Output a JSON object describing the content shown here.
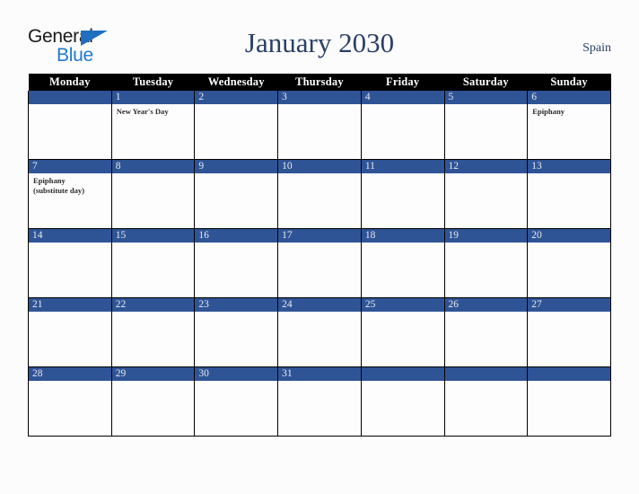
{
  "brand": {
    "name_part1": "General",
    "name_part2": "Blue",
    "accent_color": "#1f7ad0"
  },
  "header": {
    "title": "January 2030",
    "country": "Spain",
    "title_color": "#2b4066"
  },
  "calendar": {
    "month": "January",
    "year": "2030",
    "weekday_headers": [
      "Monday",
      "Tuesday",
      "Wednesday",
      "Thursday",
      "Friday",
      "Saturday",
      "Sunday"
    ],
    "header_bg": "#000000",
    "daynum_bg": "#2f5496",
    "weeks": [
      [
        {
          "day": "",
          "event": ""
        },
        {
          "day": "1",
          "event": "New Year's Day"
        },
        {
          "day": "2",
          "event": ""
        },
        {
          "day": "3",
          "event": ""
        },
        {
          "day": "4",
          "event": ""
        },
        {
          "day": "5",
          "event": ""
        },
        {
          "day": "6",
          "event": "Epiphany"
        }
      ],
      [
        {
          "day": "7",
          "event": "Epiphany\n(substitute day)"
        },
        {
          "day": "8",
          "event": ""
        },
        {
          "day": "9",
          "event": ""
        },
        {
          "day": "10",
          "event": ""
        },
        {
          "day": "11",
          "event": ""
        },
        {
          "day": "12",
          "event": ""
        },
        {
          "day": "13",
          "event": ""
        }
      ],
      [
        {
          "day": "14",
          "event": ""
        },
        {
          "day": "15",
          "event": ""
        },
        {
          "day": "16",
          "event": ""
        },
        {
          "day": "17",
          "event": ""
        },
        {
          "day": "18",
          "event": ""
        },
        {
          "day": "19",
          "event": ""
        },
        {
          "day": "20",
          "event": ""
        }
      ],
      [
        {
          "day": "21",
          "event": ""
        },
        {
          "day": "22",
          "event": ""
        },
        {
          "day": "23",
          "event": ""
        },
        {
          "day": "24",
          "event": ""
        },
        {
          "day": "25",
          "event": ""
        },
        {
          "day": "26",
          "event": ""
        },
        {
          "day": "27",
          "event": ""
        }
      ],
      [
        {
          "day": "28",
          "event": ""
        },
        {
          "day": "29",
          "event": ""
        },
        {
          "day": "30",
          "event": ""
        },
        {
          "day": "31",
          "event": ""
        },
        {
          "day": "",
          "event": ""
        },
        {
          "day": "",
          "event": ""
        },
        {
          "day": "",
          "event": ""
        }
      ]
    ]
  }
}
